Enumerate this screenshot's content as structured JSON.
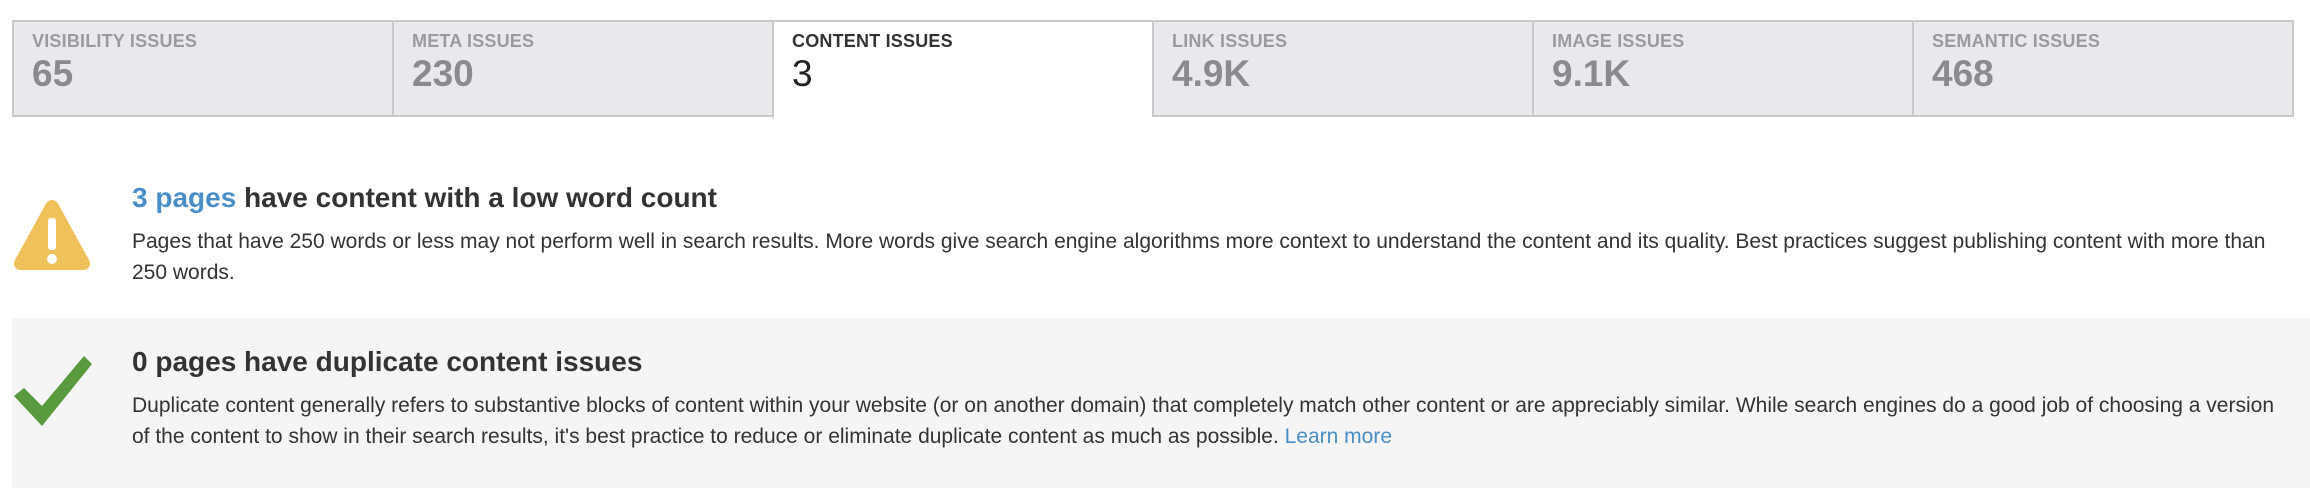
{
  "tabs": [
    {
      "label": "VISIBILITY ISSUES",
      "value": "65",
      "active": false
    },
    {
      "label": "META ISSUES",
      "value": "230",
      "active": false
    },
    {
      "label": "CONTENT ISSUES",
      "value": "3",
      "active": true
    },
    {
      "label": "LINK ISSUES",
      "value": "4.9K",
      "active": false
    },
    {
      "label": "IMAGE ISSUES",
      "value": "9.1K",
      "active": false
    },
    {
      "label": "SEMANTIC ISSUES",
      "value": "468",
      "active": false
    }
  ],
  "issues": {
    "low_word_count": {
      "icon": "warning-triangle-icon",
      "status": "warning",
      "count_link": "3 pages",
      "title_rest": "have content with a low word count",
      "description": "Pages that have 250 words or less may not perform well in search results. More words give search engine algorithms more context to understand the content and its quality. Best practices suggest publishing content with more than 250 words."
    },
    "duplicate_content": {
      "icon": "checkmark-icon",
      "status": "ok",
      "title": "0 pages have duplicate content issues",
      "description": "Duplicate content generally refers to substantive blocks of content within your website (or on another domain) that completely match other content or are appreciably similar. While search engines do a good job of choosing a version of the content to show in their search results, it's best practice to reduce or eliminate duplicate content as much as possible.",
      "learn_more": "Learn more"
    }
  },
  "colors": {
    "link": "#4a8ec9",
    "warning": "#f0c158",
    "ok": "#5a9a3e",
    "tab_bg": "#e9e9eb",
    "tab_border": "#c9c9cc",
    "ok_row_bg": "#f5f5f6"
  }
}
